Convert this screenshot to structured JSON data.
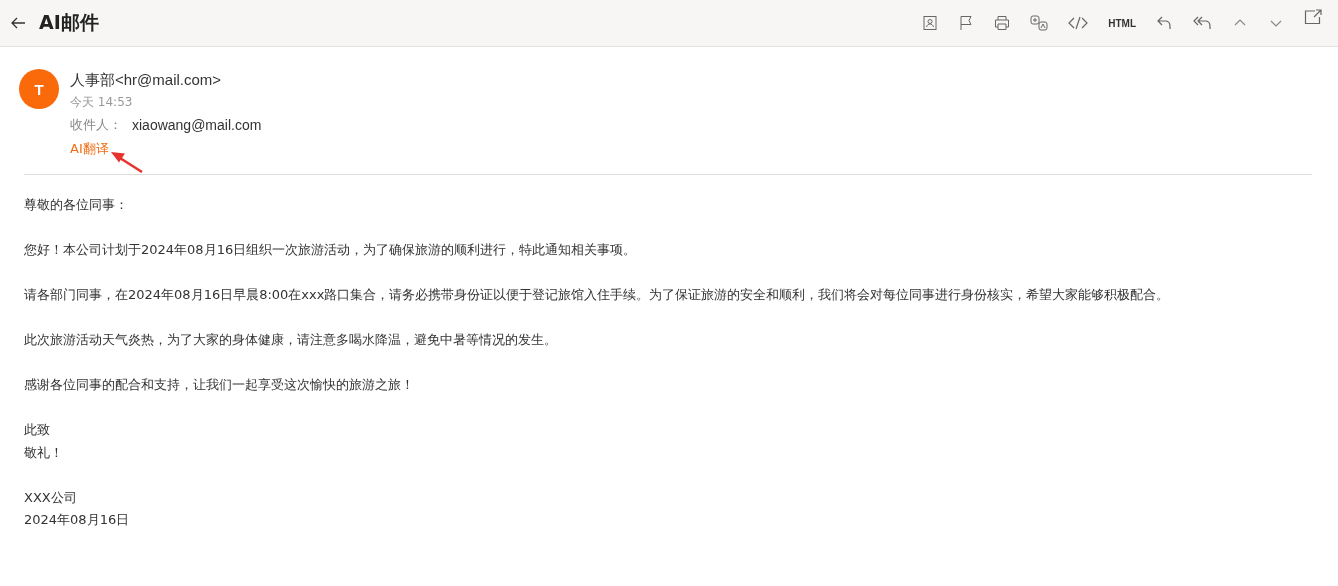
{
  "header": {
    "title": "AI邮件",
    "toolbar": {
      "format_label": "HTML"
    }
  },
  "message": {
    "avatar": "T",
    "sender": "人事部<hr@mail.com>",
    "time": "今天 14:53",
    "recipient_label": "收件人：",
    "recipient": "xiaowang@mail.com",
    "translate_link": "AI翻译",
    "body": [
      [
        "尊敬的各位同事："
      ],
      [
        "您好！本公司计划于2024年08月16日组织一次旅游活动，为了确保旅游的顺利进行，特此通知相关事项。"
      ],
      [
        "请各部门同事，在2024年08月16日早晨8:00在xxx路口集合，请务必携带身份证以便于登记旅馆入住手续。为了保证旅游的安全和顺利，我们将会对每位同事进行身份核实，希望大家能够积极配合。"
      ],
      [
        "此次旅游活动天气炎热，为了大家的身体健康，请注意多喝水降温，避免中暑等情况的发生。"
      ],
      [
        "感谢各位同事的配合和支持，让我们一起享受这次愉快的旅游之旅！"
      ],
      [
        "此致",
        "敬礼！"
      ],
      [
        "XXX公司",
        "2024年08月16日"
      ]
    ]
  }
}
